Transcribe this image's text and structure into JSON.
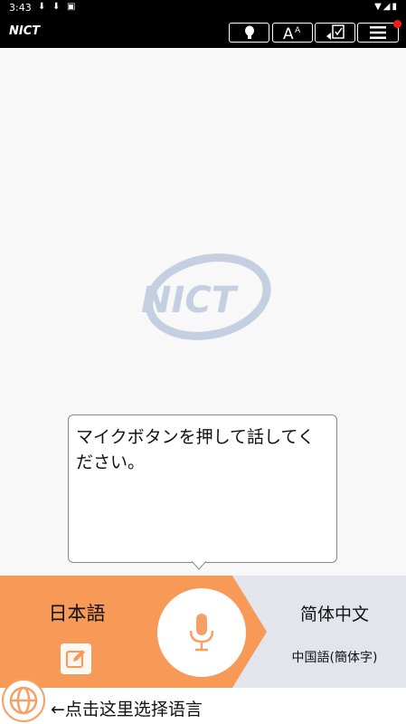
{
  "status_bar": {
    "time": "3:43"
  },
  "app_bar": {
    "logo": "NICT"
  },
  "watermark": {
    "text": "NICT"
  },
  "prompt_bubble": {
    "text": "マイクボタンを押して話してください。"
  },
  "languages": {
    "source": "日本語",
    "target": "简体中文",
    "target_sub": "中国語(簡体字)"
  },
  "hint": {
    "text": "←点击这里选择语言"
  },
  "colors": {
    "accent_orange": "#f89a57",
    "target_bg": "#e2e5ec",
    "mic_orange": "#f6a066"
  }
}
